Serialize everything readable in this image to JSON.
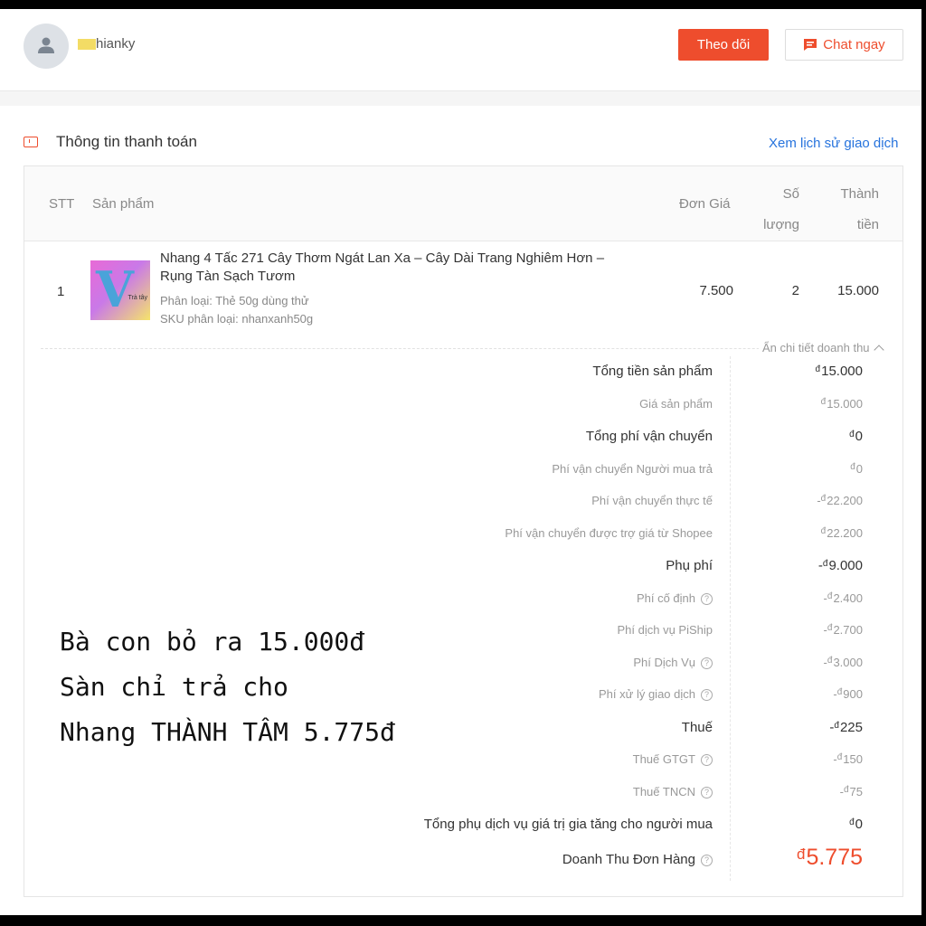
{
  "header": {
    "username": "hianky",
    "follow_label": "Theo dõi",
    "chat_label": "Chat ngay"
  },
  "section": {
    "title": "Thông tin thanh toán",
    "history_link": "Xem lịch sử giao dịch"
  },
  "table": {
    "headers": {
      "stt": "STT",
      "product": "Sản phẩm",
      "price": "Đơn Giá",
      "qty_line1": "Số",
      "qty_line2": "lượng",
      "total_line1": "Thành",
      "total_line2": "tiền"
    },
    "row": {
      "stt": "1",
      "name": "Nhang 4 Tấc 271 Cây Thơm Ngát Lan Xa – Cây Dài Trang Nghiêm Hơn – Rụng Tàn Sạch Tươm",
      "variant": "Phân loại: Thẻ 50g dùng thử",
      "sku": "SKU phân loại: nhanxanh50g",
      "thumb_text": "Trà tây",
      "price": "7.500",
      "qty": "2",
      "total": "15.000"
    }
  },
  "revenue": {
    "toggle_label": "Ẩn chi tiết doanh thu",
    "currency_symbol": "đ",
    "lines": [
      {
        "label": "Tổng tiền sản phẩm",
        "value": "15.000",
        "sign": ""
      },
      {
        "label": "Giá sản phẩm",
        "value": "15.000",
        "sign": ""
      },
      {
        "label": "Tổng phí vận chuyển",
        "value": "0",
        "sign": ""
      },
      {
        "label": "Phí vận chuyển Người mua trả",
        "value": "0",
        "sign": ""
      },
      {
        "label": "Phí vận chuyển thực tế",
        "value": "22.200",
        "sign": "-"
      },
      {
        "label": "Phí vận chuyển được trợ giá từ Shopee",
        "value": "22.200",
        "sign": ""
      },
      {
        "label": "Phụ phí",
        "value": "9.000",
        "sign": "-"
      },
      {
        "label": "Phí cố định",
        "value": "2.400",
        "sign": "-"
      },
      {
        "label": "Phí dịch vụ PiShip",
        "value": "2.700",
        "sign": "-"
      },
      {
        "label": "Phí Dịch Vụ",
        "value": "3.000",
        "sign": "-"
      },
      {
        "label": "Phí xử lý giao dịch",
        "value": "900",
        "sign": "-"
      },
      {
        "label": "Thuế",
        "value": "225",
        "sign": "-"
      },
      {
        "label": "Thuế GTGT",
        "value": "150",
        "sign": "-"
      },
      {
        "label": "Thuế TNCN",
        "value": "75",
        "sign": "-"
      },
      {
        "label": "Tổng phụ dịch vụ giá trị gia tăng cho người mua",
        "value": "0",
        "sign": ""
      },
      {
        "label": "Doanh Thu Đơn Hàng",
        "value": "5.775",
        "sign": ""
      }
    ]
  },
  "overlay": {
    "line1": "Bà con bỏ ra 15.000đ",
    "line2": "Sàn chỉ trả cho",
    "line3": "Nhang THÀNH TÂM  5.775đ"
  },
  "colors": {
    "accent": "#ee4d2d",
    "link": "#2673dd"
  }
}
